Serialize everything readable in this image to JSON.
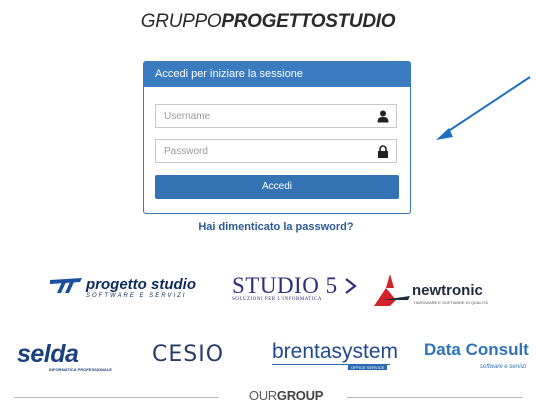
{
  "brand": {
    "part1": "GRUPPO",
    "part2": "PROGETTOSTUDIO"
  },
  "login": {
    "header": "Accedi per iniziare la sessione",
    "username_placeholder": "Username",
    "password_placeholder": "Password",
    "submit_label": "Accedi",
    "forgot_link": "Hai dimenticato la password?"
  },
  "partners": {
    "progetto_studio": {
      "name": "progetto studio",
      "tagline": "SOFTWARE E SERVIZI"
    },
    "studio5": {
      "name": "STUDIO 5",
      "tagline": "SOLUZIONI PER L'INFORMATICA"
    },
    "newtronic": {
      "name": "newtronic",
      "tagline": "HARDWARE E SOFTWARE DI QUALITÀ"
    },
    "selda": {
      "name": "selda",
      "tagline": "INFORMATICA PROFESSIONALE"
    },
    "cesio": {
      "name": "CESIO"
    },
    "brentasystem": {
      "name": "brentasystem",
      "tagline": "OFFICE SERVICE"
    },
    "data_consult": {
      "name": "Data Consult",
      "tagline": "software e servizi"
    }
  },
  "footer": {
    "part1": "OUR",
    "part2": "GROUP"
  },
  "colors": {
    "header_blue": "#3b7cc0",
    "button_blue": "#3473b4",
    "link_blue": "#2a5c97",
    "annotation_arrow": "#1f6fbf"
  }
}
